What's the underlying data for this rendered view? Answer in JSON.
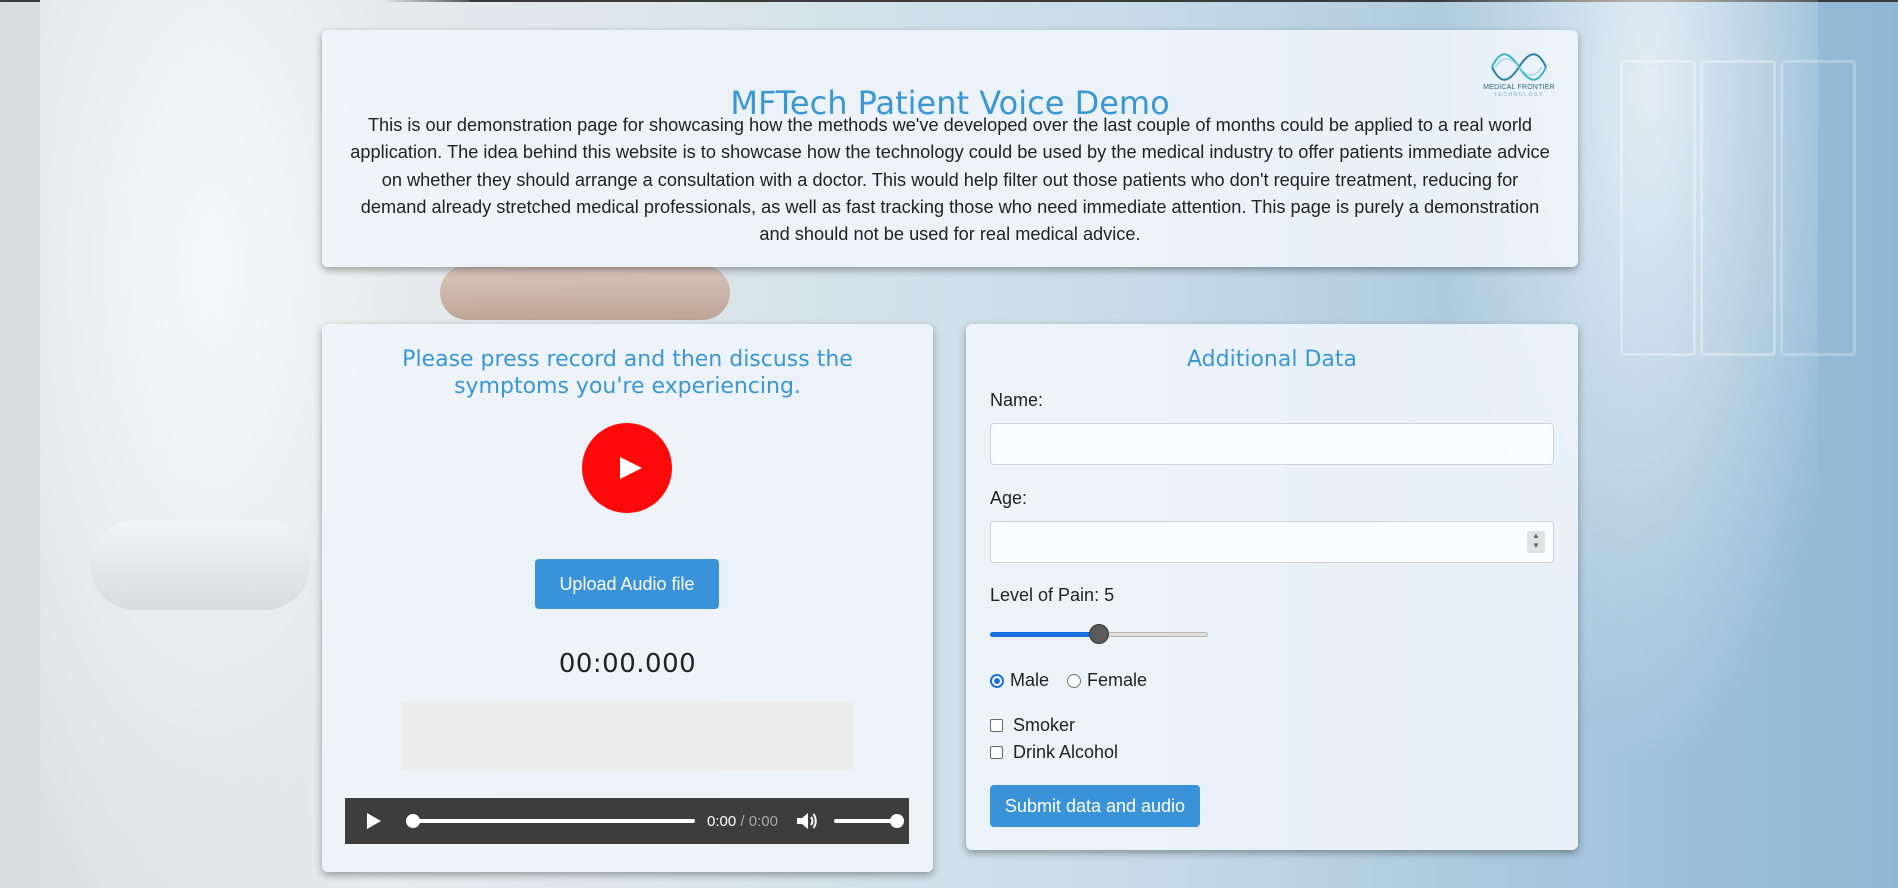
{
  "header": {
    "title": "MFTech Patient Voice Demo",
    "logo_text": "MEDICAL FRONTIER",
    "logo_subtext": "TECHNOLOGY",
    "intro": "This is our demonstration page for showcasing how the methods we've developed over the last couple of months could be applied to a real world application. The idea behind this website is to showcase how the technology could be used by the medical industry to offer patients immediate advice on whether they should arrange a consultation with a doctor. This would help filter out those patients who don't require treatment, reducing for demand already stretched medical professionals, as well as fast tracking those who need immediate attention. This page is purely a demonstration and should not be used for real medical advice."
  },
  "recorder": {
    "heading": "Please press record and then discuss the symptoms you're experiencing.",
    "record_icon": "play-icon",
    "upload_label": "Upload Audio file",
    "timer": "00:00.000",
    "player": {
      "current_time": "0:00",
      "separator": "/",
      "duration": "0:00",
      "progress": 0,
      "volume": 1.0
    }
  },
  "form": {
    "heading": "Additional Data",
    "name_label": "Name:",
    "name_value": "",
    "age_label": "Age:",
    "age_value": "",
    "pain_label": "Level of Pain: 5",
    "pain_value": 5,
    "pain_min": 0,
    "pain_max": 10,
    "gender_options": [
      {
        "label": "Male",
        "checked": true
      },
      {
        "label": "Female",
        "checked": false
      }
    ],
    "checkboxes": [
      {
        "label": "Smoker",
        "checked": false
      },
      {
        "label": "Drink Alcohol",
        "checked": false
      }
    ],
    "submit_label": "Submit data and audio"
  },
  "colors": {
    "accent": "#3a97d4",
    "button": "#3a93d8",
    "record": "#fe0a0a",
    "slider_fill": "#1a6fe0"
  }
}
